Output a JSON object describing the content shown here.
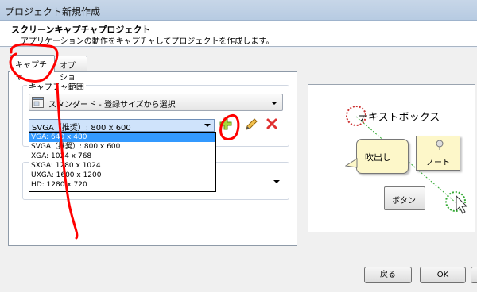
{
  "window": {
    "title": "プロジェクト新規作成"
  },
  "header": {
    "title": "スクリーンキャプチャプロジェクト",
    "subtitle": "アプリケーションの動作をキャプチャしてプロジェクトを作成します。"
  },
  "tabs": [
    {
      "label": "キャプチャ",
      "selected": true
    },
    {
      "label": "オプション",
      "selected": false
    }
  ],
  "capture": {
    "group_label": "キャプチャ範囲",
    "preset": "スタンダード - 登録サイズから選択",
    "resolution_value": "SVGA（推奨）: 800 x 600",
    "resolution_options": [
      "VGA: 640 x 480",
      "SVGA（推奨）: 800 x 600",
      "XGA: 1024 x 768",
      "SXGA: 1280 x 1024",
      "UXGA: 1600 x 1200",
      "HD: 1280 x 720"
    ],
    "selected_option_index": 0
  },
  "preview": {
    "textbox_label": "テキストボックス",
    "balloon_label": "吹出し",
    "note_label": "ノート",
    "button_label": "ボタン"
  },
  "footer": {
    "back_label": "戻る",
    "ok_label": "OK"
  },
  "icons": {
    "add": "plus-icon",
    "edit": "pencil-icon",
    "delete": "x-icon",
    "preset": "window-icon"
  },
  "colors": {
    "selection": "#3399ff",
    "annotation": "#ff0000",
    "add_icon": "#7fbf1f",
    "delete_icon": "#e03030"
  }
}
